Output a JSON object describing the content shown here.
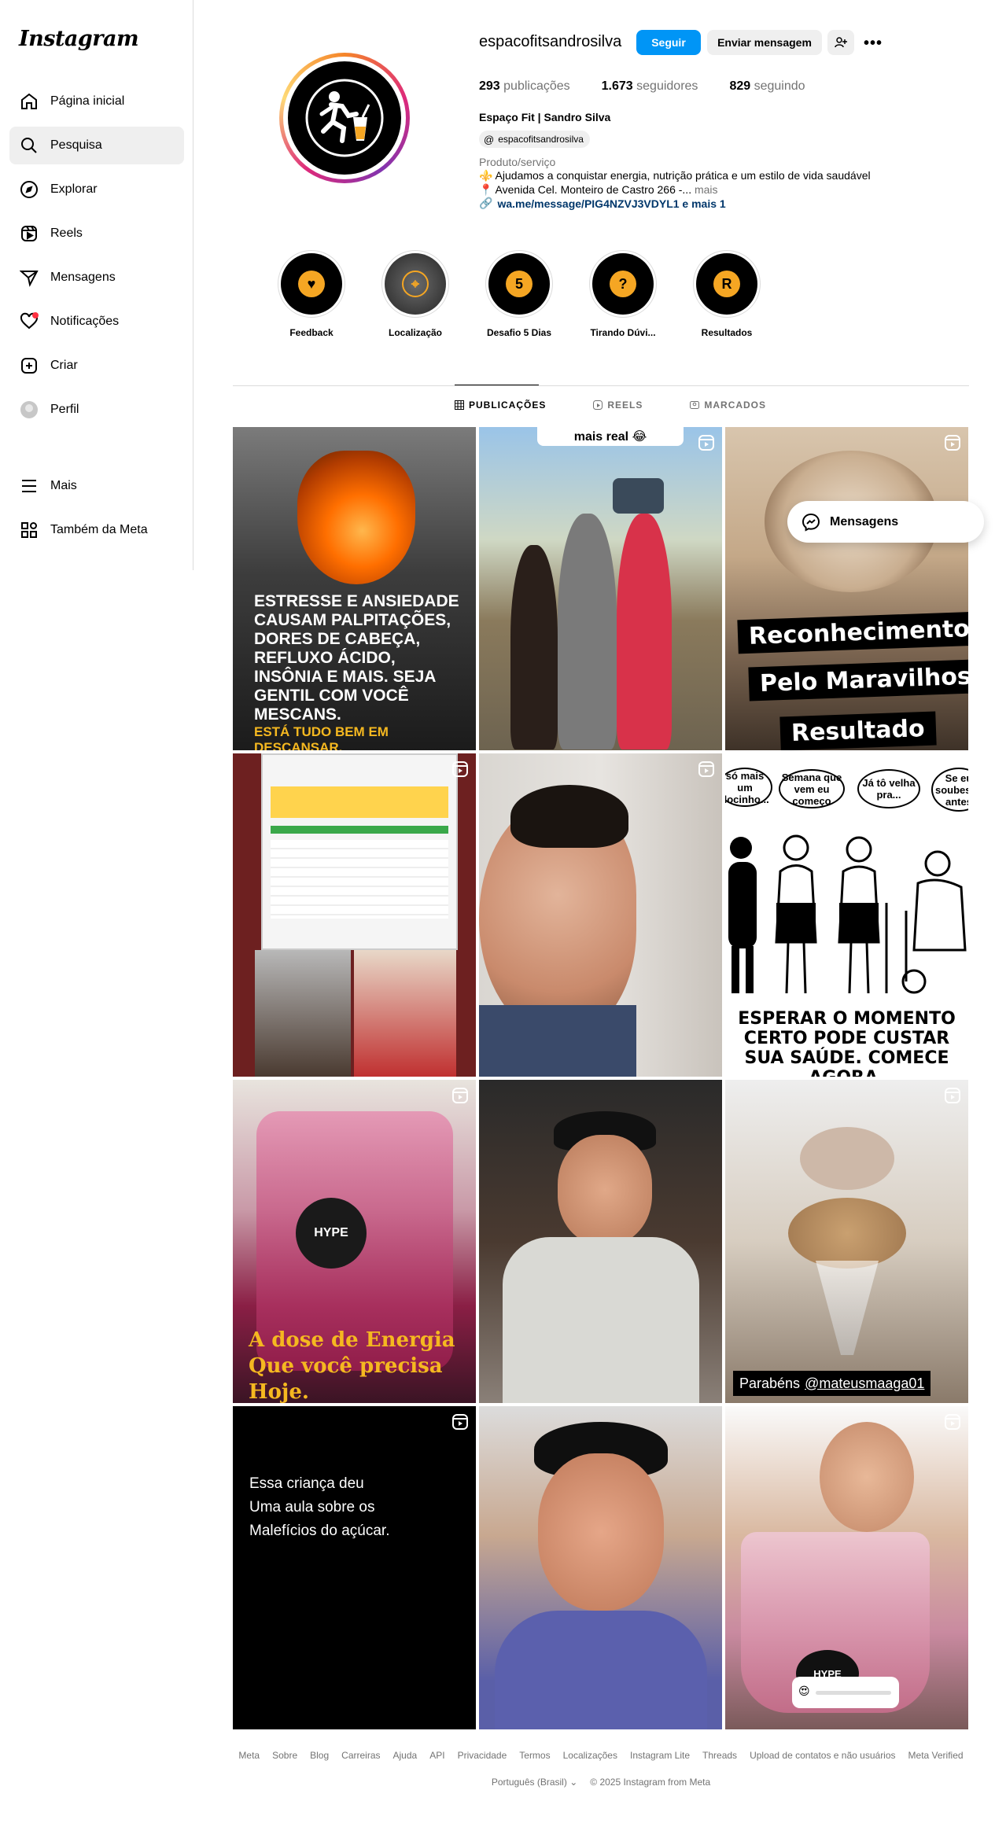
{
  "sidebar": {
    "logo": "Instagram",
    "items": [
      {
        "label": "Página inicial",
        "icon": "home-icon"
      },
      {
        "label": "Pesquisa",
        "icon": "search-icon"
      },
      {
        "label": "Explorar",
        "icon": "compass-icon"
      },
      {
        "label": "Reels",
        "icon": "reels-icon"
      },
      {
        "label": "Mensagens",
        "icon": "direct-icon"
      },
      {
        "label": "Notificações",
        "icon": "heart-icon"
      },
      {
        "label": "Criar",
        "icon": "plus-icon"
      },
      {
        "label": "Perfil",
        "icon": "avatar"
      }
    ],
    "bottom": [
      {
        "label": "Mais",
        "icon": "menu-icon"
      },
      {
        "label": "Também da Meta",
        "icon": "grid-icon"
      }
    ]
  },
  "profile": {
    "username": "espacofitsandrosilva",
    "follow_label": "Seguir",
    "message_label": "Enviar mensagem",
    "more_label": "•••",
    "posts_count": "293",
    "posts_label": "publicações",
    "followers_count": "1.673",
    "followers_label": "seguidores",
    "following_count": "829",
    "following_label": "seguindo",
    "full_name": "Espaço Fit | Sandro Silva",
    "threads_handle": "espacofitsandrosilva",
    "category": "Produto/serviço",
    "bio_line1": "⚜️ Ajudamos a conquistar energia, nutrição prática e um estilo de vida saudável",
    "bio_line2": "📍 Avenida Cel. Monteiro de Castro 266 -...",
    "bio_more": "mais",
    "link": "wa.me/message/PIG4NZVJ3VDYL1 e mais 1"
  },
  "highlights": [
    {
      "label": "Feedback",
      "glyph": "♥"
    },
    {
      "label": "Localização",
      "glyph": "⌖"
    },
    {
      "label": "Desafio 5 Dias",
      "glyph": "5"
    },
    {
      "label": "Tirando Dúvi...",
      "glyph": "?"
    },
    {
      "label": "Resultados",
      "glyph": "R"
    }
  ],
  "tabs": [
    {
      "label": "PUBLICAÇÕES",
      "icon": "grid-small-icon"
    },
    {
      "label": "REELS",
      "icon": "reels-small-icon"
    },
    {
      "label": "MARCADOS",
      "icon": "tag-icon"
    }
  ],
  "posts": {
    "p1_text": "ESTRESSE E ANSIEDADE CAUSAM PALPITAÇÕES, DORES DE CABEÇA, REFLUXO ÁCIDO, INSÔNIA E MAIS. SEJA GENTIL COM VOCÊ MESCANS.",
    "p1_highlight": "ESTÁ TUDO BEM EM DESCANSAR.",
    "p2_sticker": "mais real 😂",
    "p3_banner1": "Reconhecimento",
    "p3_banner2": "Pelo Maravilhoso",
    "p3_banner3": "Resultado",
    "p6_b1": "só mais um docinho...",
    "p6_b2": "Semana que vem eu começo",
    "p6_b3": "Já tô velha pra...",
    "p6_b4": "Se eu soubesse antes",
    "p6_caption": "ESPERAR O MOMENTO CERTO PODE CUSTAR SUA SAÚDE. COMECE AGORA.",
    "p7_text": "A dose de Energia Que você precisa Hoje.",
    "p9_caption": "Parabéns",
    "p9_mention": "@mateusmaaga01",
    "p10_text_1": "Essa criança deu",
    "p10_text_2": "Uma aula sobre os",
    "p10_text_3": "Malefícios do açúcar."
  },
  "floating_messages": "Mensagens",
  "footer": {
    "links": [
      "Meta",
      "Sobre",
      "Blog",
      "Carreiras",
      "Ajuda",
      "API",
      "Privacidade",
      "Termos",
      "Localizações",
      "Instagram Lite",
      "Threads",
      "Upload de contatos e não usuários",
      "Meta Verified"
    ],
    "language": "Português (Brasil)",
    "copyright": "© 2025 Instagram from Meta"
  },
  "colors": {
    "accent": "#0095f6",
    "highlight_badge": "#f5a623",
    "notification": "#ff3040"
  }
}
